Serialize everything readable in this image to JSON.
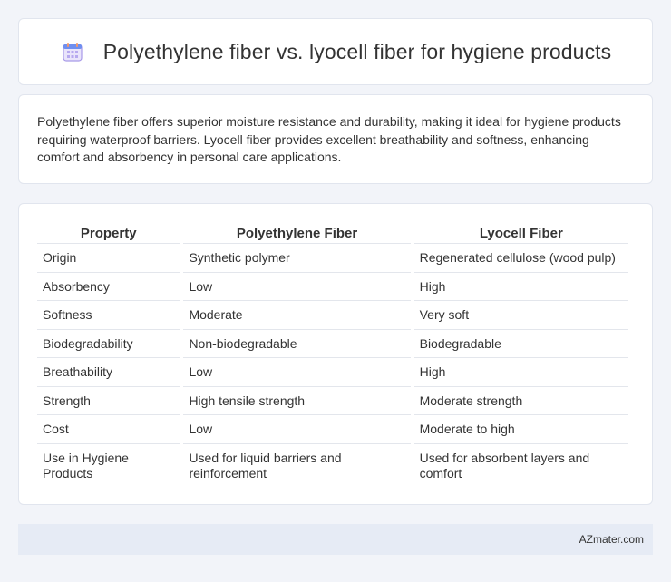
{
  "header": {
    "title": "Polyethylene fiber vs. lyocell fiber for hygiene products",
    "icon": "calendar-icon",
    "icon_color": "#8c7be0"
  },
  "summary": {
    "text": "Polyethylene fiber offers superior moisture resistance and durability, making it ideal for hygiene products requiring waterproof barriers. Lyocell fiber provides excellent breathability and softness, enhancing comfort and absorbency in personal care applications."
  },
  "table": {
    "headers": [
      "Property",
      "Polyethylene Fiber",
      "Lyocell Fiber"
    ],
    "rows": [
      [
        "Origin",
        "Synthetic polymer",
        "Regenerated cellulose (wood pulp)"
      ],
      [
        "Absorbency",
        "Low",
        "High"
      ],
      [
        "Softness",
        "Moderate",
        "Very soft"
      ],
      [
        "Biodegradability",
        "Non-biodegradable",
        "Biodegradable"
      ],
      [
        "Breathability",
        "Low",
        "High"
      ],
      [
        "Strength",
        "High tensile strength",
        "Moderate strength"
      ],
      [
        "Cost",
        "Low",
        "Moderate to high"
      ],
      [
        "Use in Hygiene Products",
        "Used for liquid barriers and reinforcement",
        "Used for absorbent layers and comfort"
      ]
    ]
  },
  "footer": {
    "text": "AZmater.com"
  }
}
